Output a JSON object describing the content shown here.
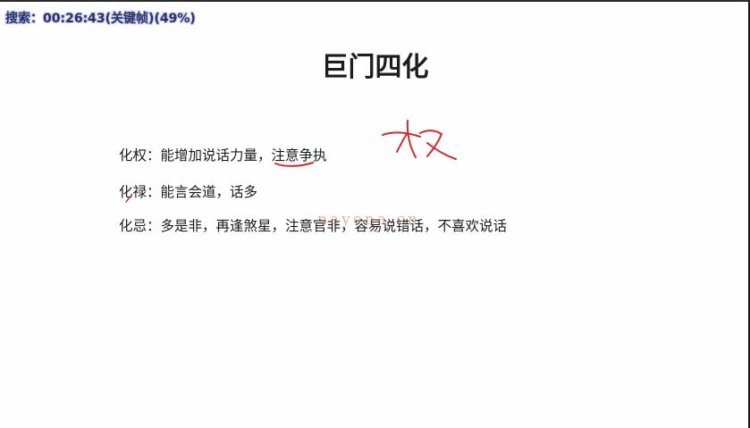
{
  "overlay": {
    "text": "搜索：00:26:43(关键帧)(49%)"
  },
  "slide": {
    "title": "巨门四化",
    "lines": [
      {
        "label": "化权",
        "sep": "：",
        "text": "能增加说话力量，注意争执"
      },
      {
        "label": "化禄",
        "sep": "：",
        "text": "能言会道，话多"
      },
      {
        "label": "化忌",
        "sep": "：",
        "text": "多是非，再逢煞星，注意官非，容易说错话，不喜欢说话"
      }
    ]
  },
  "watermark": "nayona.cn",
  "colors": {
    "ink": "#d42a2a",
    "overlay_text": "#27326e"
  }
}
